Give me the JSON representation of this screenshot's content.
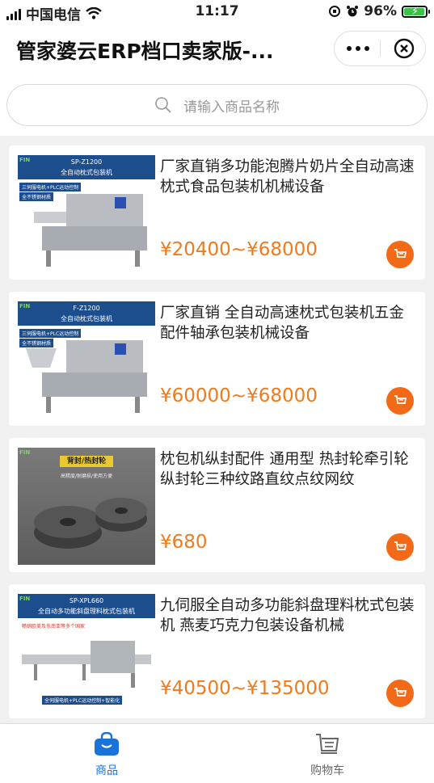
{
  "status_bar": {
    "carrier": "中国电信",
    "time": "11:17",
    "battery": "96%"
  },
  "nav": {
    "title": "管家婆云ERP档口卖家版-..."
  },
  "search": {
    "placeholder": "请输入商品名称"
  },
  "products": [
    {
      "title": "厂家直销多功能泡腾片奶片全自动高速枕式食品包装机机械设备",
      "price": "¥20400~¥68000",
      "image": {
        "banner": "SP-Z1200",
        "banner_sub": "全自动枕式包装机",
        "tags": [
          "三伺服电机+PLC运动控制",
          "全不锈钢材质"
        ]
      }
    },
    {
      "title": "厂家直销 全自动高速枕式包装机五金配件轴承包装机械设备",
      "price": "¥60000~¥68000",
      "image": {
        "banner": "F-Z1200",
        "banner_sub": "全自动枕式包装机",
        "tags": [
          "三伺服电机+PLC运动控制",
          "全不锈钢材质"
        ]
      }
    },
    {
      "title": "枕包机纵封配件 通用型 热封轮牵引轮纵封轮三种纹路直纹点纹网纹",
      "price": "¥680",
      "image": {
        "banner": "背封/热封轮",
        "banner_sub": "高精度/耐磨损/使用方便"
      }
    },
    {
      "title": "九伺服全自动多功能斜盘理料枕式包装机 燕麦巧克力包装设备机械",
      "price": "¥40500~¥135000",
      "image": {
        "banner": "SP-XPL660",
        "banner_sub": "全自动多功能斜盘理料枕式包装机",
        "tags": [
          "畅销欧美及东南亚等多个国家",
          "全伺服电机+PLC运动控制+智能化"
        ]
      }
    }
  ],
  "tabbar": {
    "tabs": [
      {
        "label": "商品",
        "active": true
      },
      {
        "label": "购物车",
        "active": false
      }
    ]
  },
  "colors": {
    "price": "#f07a1c",
    "cart_button": "#f26a17",
    "tab_active": "#1a73d9",
    "battery_fill": "#3cc24b"
  }
}
